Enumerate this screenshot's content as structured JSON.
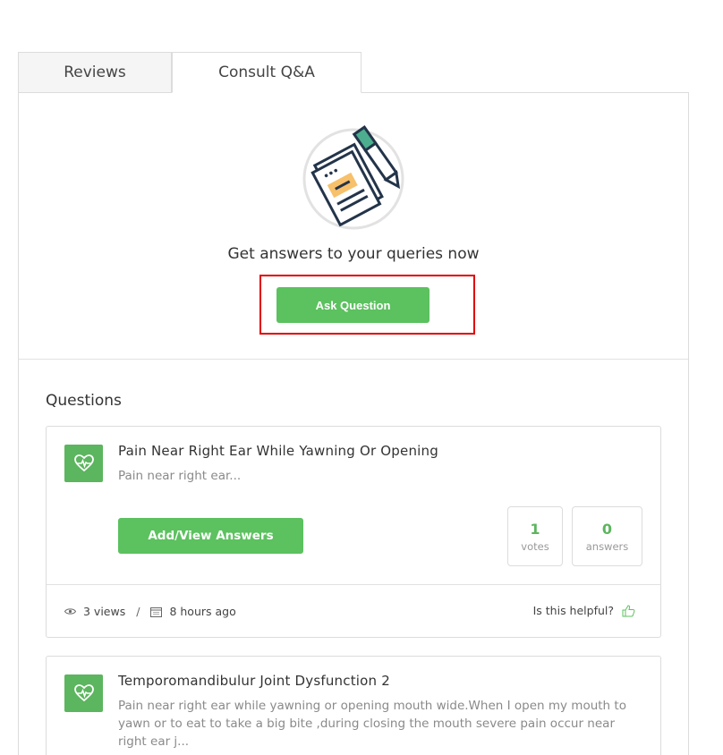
{
  "tabs": [
    {
      "label": "Reviews",
      "active": false
    },
    {
      "label": "Consult Q&A",
      "active": true
    }
  ],
  "hero": {
    "icon": "document-pen-icon",
    "text": "Get answers to your queries now",
    "ask_button": "Ask Question"
  },
  "questions": {
    "title": "Questions",
    "items": [
      {
        "icon": "heart-pulse-icon",
        "title": "Pain Near Right Ear While Yawning Or Opening",
        "description": "Pain near right ear...",
        "action_label": "Add/View Answers",
        "votes": "1",
        "votes_label": "votes",
        "answers": "0",
        "answers_label": "answers",
        "views": "3 views",
        "separator": "/",
        "time": "8 hours ago",
        "helpful_label": "Is this helpful?"
      },
      {
        "icon": "heart-pulse-icon",
        "title": "Temporomandibulur Joint Dysfunction 2",
        "description": "Pain near right ear while yawning or opening mouth wide.When I open my mouth to yawn or to eat to take a big bite ,during closing the mouth severe pain occur near right ear j..."
      }
    ]
  },
  "colors": {
    "accent_green": "#5cc15f",
    "highlight_red": "#e00000",
    "border": "#dcdcdc"
  }
}
